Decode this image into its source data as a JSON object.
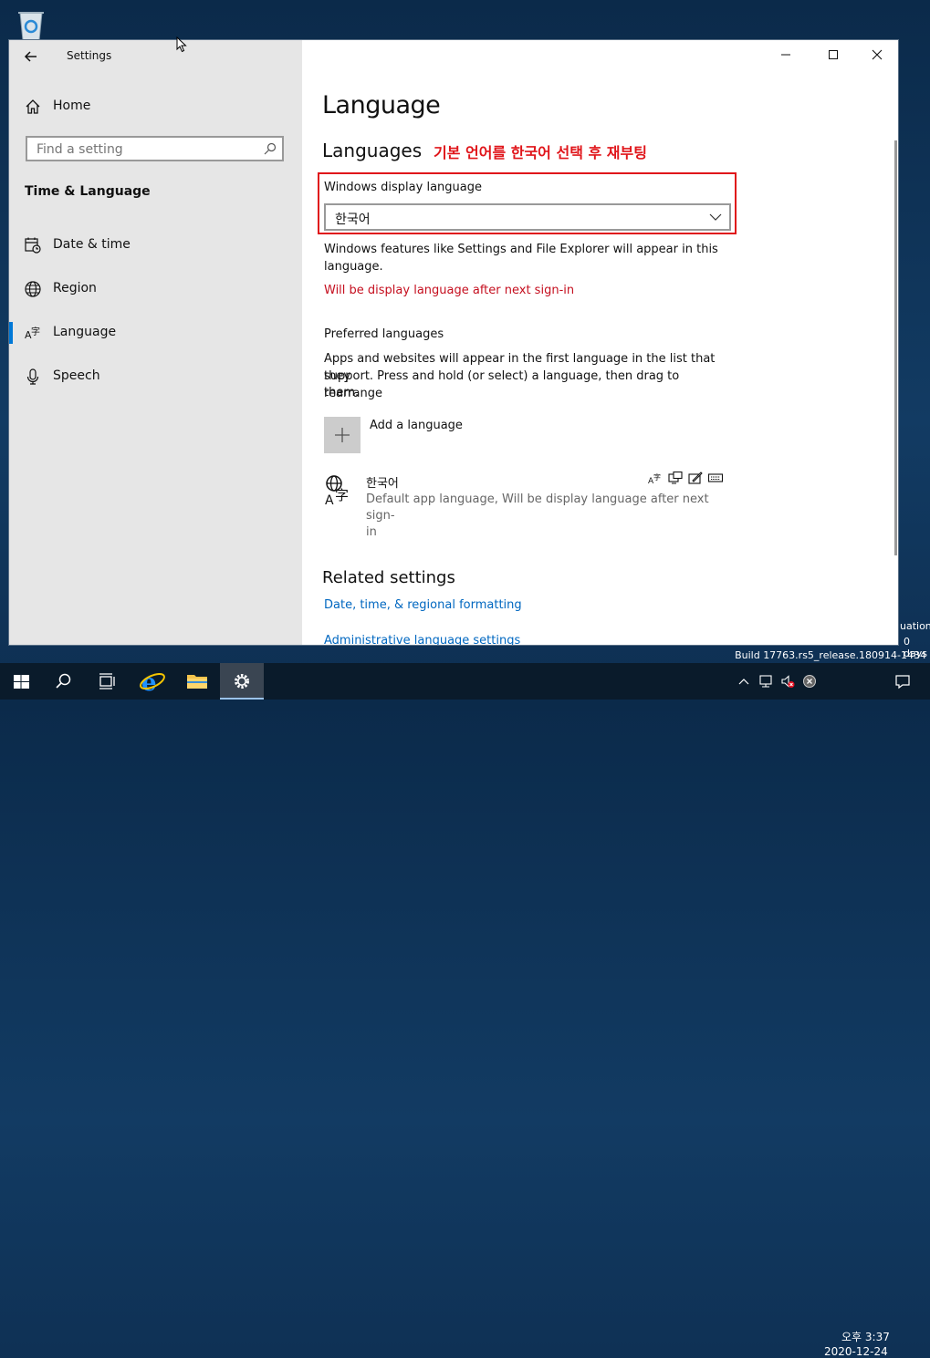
{
  "window": {
    "title": "Settings",
    "back_icon": "back-arrow-icon",
    "caption": [
      "minimize-icon",
      "maximize-icon",
      "close-icon"
    ]
  },
  "sidebar": {
    "home": "Home",
    "search_placeholder": "Find a setting",
    "section_title": "Time & Language",
    "items": [
      {
        "label": "Date & time",
        "icon": "calendar-clock-icon"
      },
      {
        "label": "Region",
        "icon": "globe-icon"
      },
      {
        "label": "Language",
        "icon": "language-icon"
      },
      {
        "label": "Speech",
        "icon": "microphone-icon"
      }
    ]
  },
  "main": {
    "title": "Language",
    "languages_heading": "Languages",
    "annotation": "기본 언어를 한국어 선택 후 재부팅",
    "display_language_label": "Windows display language",
    "display_language_value": "한국어",
    "display_language_info_1": "Windows features like Settings and File Explorer will appear in this",
    "display_language_info_2": "language.",
    "pending_notice": "Will be display language after next sign-in",
    "preferred_heading": "Preferred languages",
    "preferred_info_1": "Apps and websites will appear in the first language in the list that they",
    "preferred_info_2": "support. Press and hold (or select) a language, then drag to rearrange",
    "preferred_info_3": "them.",
    "add_language": "Add a language",
    "language_item": {
      "name": "한국어",
      "desc_1": "Default app language, Will be display language after next sign-",
      "desc_2": "in",
      "feature_icons": [
        "language-pack-icon",
        "display-icon",
        "handwriting-icon",
        "keyboard-icon"
      ]
    },
    "related_heading": "Related settings",
    "links": [
      "Date, time, & regional formatting",
      "Administrative language settings"
    ]
  },
  "desktop": {
    "watermark_1": "uation",
    "watermark_2": "0 days",
    "build": "Build 17763.rs5_release.180914-1434"
  },
  "taskbar": {
    "time": "오후 3:37",
    "date": "2020-12-24"
  },
  "colors": {
    "accent": "#0078d7",
    "annotation_red": "#e0151a",
    "link_blue": "#0067c0"
  }
}
